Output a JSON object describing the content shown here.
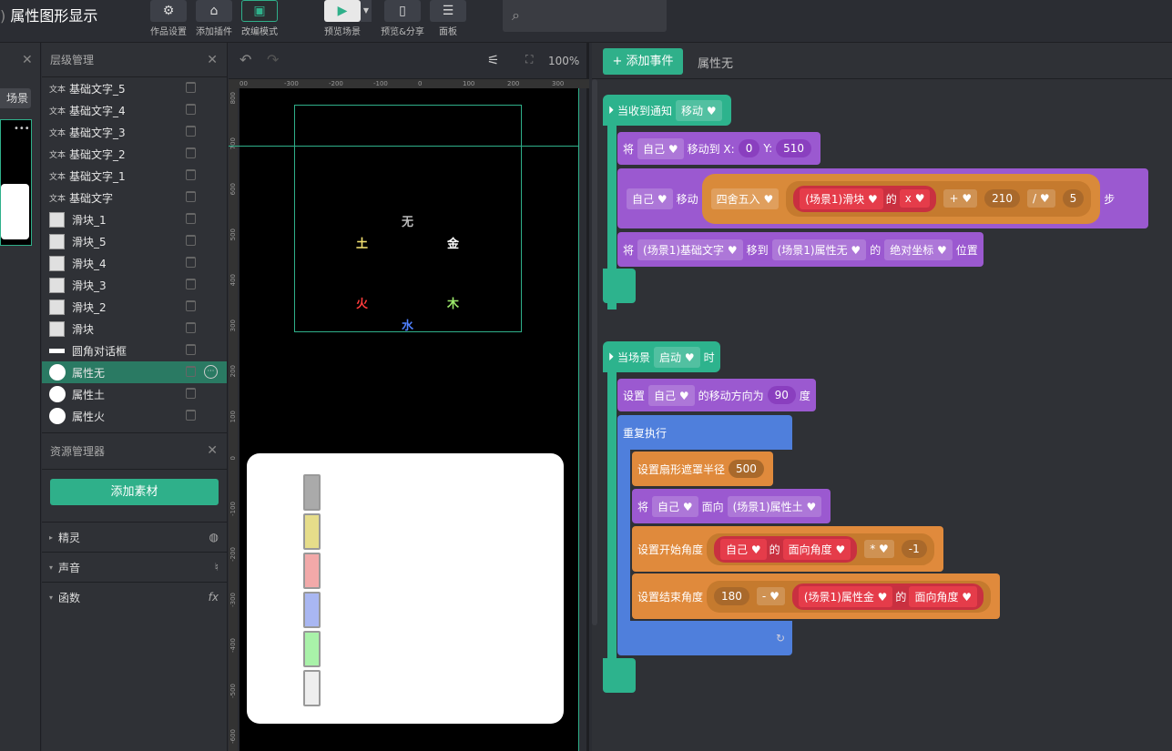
{
  "app": {
    "title": "属性图形显示"
  },
  "toolbar": {
    "settings": "作品设置",
    "plugins": "添加插件",
    "mode": "改编模式",
    "preview": "预览场景",
    "share": "预览&分享",
    "panel": "面板"
  },
  "leftstrip": {
    "scene_btn": "场景"
  },
  "layers": {
    "title": "层级管理",
    "items": [
      {
        "type": "text",
        "label": "基础文字_5"
      },
      {
        "type": "text",
        "label": "基础文字_4"
      },
      {
        "type": "text",
        "label": "基础文字_3"
      },
      {
        "type": "text",
        "label": "基础文字_2"
      },
      {
        "type": "text",
        "label": "基础文字_1"
      },
      {
        "type": "text",
        "label": "基础文字"
      },
      {
        "type": "slider",
        "label": "滑块_1"
      },
      {
        "type": "slider",
        "label": "滑块_5"
      },
      {
        "type": "slider",
        "label": "滑块_4"
      },
      {
        "type": "slider",
        "label": "滑块_3"
      },
      {
        "type": "slider",
        "label": "滑块_2"
      },
      {
        "type": "slider",
        "label": "滑块"
      },
      {
        "type": "bar",
        "label": "圆角对话框"
      },
      {
        "type": "circle",
        "label": "属性无",
        "selected": true
      },
      {
        "type": "circle",
        "label": "属性土"
      },
      {
        "type": "circle",
        "label": "属性火"
      }
    ],
    "text_icon": "文本"
  },
  "assets": {
    "title": "资源管理器",
    "add": "添加素材",
    "sections": [
      "精灵",
      "声音",
      "函数"
    ],
    "fx": "fx"
  },
  "stage": {
    "zoom": "100%",
    "ticks_h": [
      "00",
      "-300",
      "-200",
      "-100",
      "0",
      "100",
      "200",
      "300"
    ],
    "ticks_v": [
      "800",
      "700",
      "600",
      "500",
      "400",
      "300",
      "200",
      "100",
      "0",
      "-100",
      "-200",
      "-300",
      "-400",
      "-500",
      "-600"
    ],
    "elements": {
      "none": "无",
      "earth": "土",
      "metal": "金",
      "fire": "火",
      "wood": "木",
      "water": "水"
    },
    "colors": {
      "none": "#bbbbbb",
      "earth": "#f2e070",
      "metal": "#ffffff",
      "fire": "#ff3b3b",
      "wood": "#9be86a",
      "water": "#4f80ff"
    },
    "sliders": [
      "#aaaaaa",
      "#e6dd8a",
      "#f2a9a9",
      "#a9b7f2",
      "#a9f2a9",
      "#eeeeee"
    ]
  },
  "editor": {
    "add_event": "添加事件",
    "target": "属性无",
    "b1": {
      "head": "当收到通知",
      "head_dd": "移动",
      "l1": {
        "a": "将",
        "dd": "自己",
        "b": "移动到 X:",
        "x": "0",
        "c": "Y:",
        "y": "510"
      },
      "l2": {
        "dd": "自己",
        "a": "移动",
        "round": "四舍五入",
        "obj": "(场景1)滑块",
        "of": "的",
        "prop": "x",
        "op1": "+",
        "n1": "210",
        "op2": "/",
        "n2": "5",
        "tail": "步"
      },
      "l3": {
        "a": "将",
        "obj": "(场景1)基础文字",
        "b": "移到",
        "obj2": "(场景1)属性无",
        "of": "的",
        "prop": "绝对坐标",
        "c": "位置"
      }
    },
    "b2": {
      "head": "当场景",
      "head_dd": "启动",
      "tail": "时",
      "l1": {
        "a": "设置",
        "dd": "自己",
        "b": "的移动方向为",
        "n": "90",
        "c": "度"
      },
      "loop": "重复执行",
      "l2": {
        "a": "设置扇形遮罩半径",
        "n": "500"
      },
      "l3": {
        "a": "将",
        "dd": "自己",
        "b": "面向",
        "obj": "(场景1)属性土"
      },
      "l4": {
        "a": "设置开始角度",
        "dd": "自己",
        "of": "的",
        "prop": "面向角度",
        "op": "*",
        "n": "-1"
      },
      "l5": {
        "a": "设置结束角度",
        "n": "180",
        "op": "-",
        "obj": "(场景1)属性金",
        "of": "的",
        "prop": "面向角度"
      }
    }
  }
}
